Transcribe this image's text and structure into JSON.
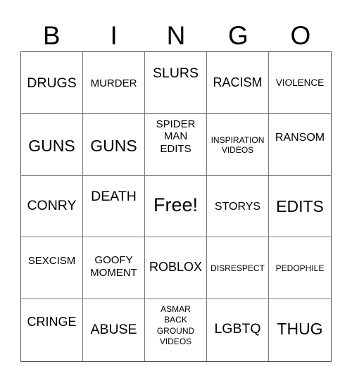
{
  "header": [
    "B",
    "I",
    "N",
    "G",
    "O"
  ],
  "cells": [
    "DRUGS",
    "MURDER",
    "SLURS",
    "RACISM",
    "VIOLENCE",
    "GUNS",
    "GUNS",
    "SPIDER\nMAN\nEDITS",
    "INSPIRATION\nVIDEOS",
    "RANSOM",
    "CONRY",
    "DEATH",
    "Free!",
    "STORYS",
    "EDITS",
    "SEXCISM",
    "GOOFY\nMOMENT",
    "ROBLOX",
    "DISRESPECT",
    "PEDOPHILE",
    "CRINGE",
    "ABUSE",
    "ASMAR\nBACK\nGROUND\nVIDEOS",
    "LGBTQ",
    "THUG"
  ]
}
